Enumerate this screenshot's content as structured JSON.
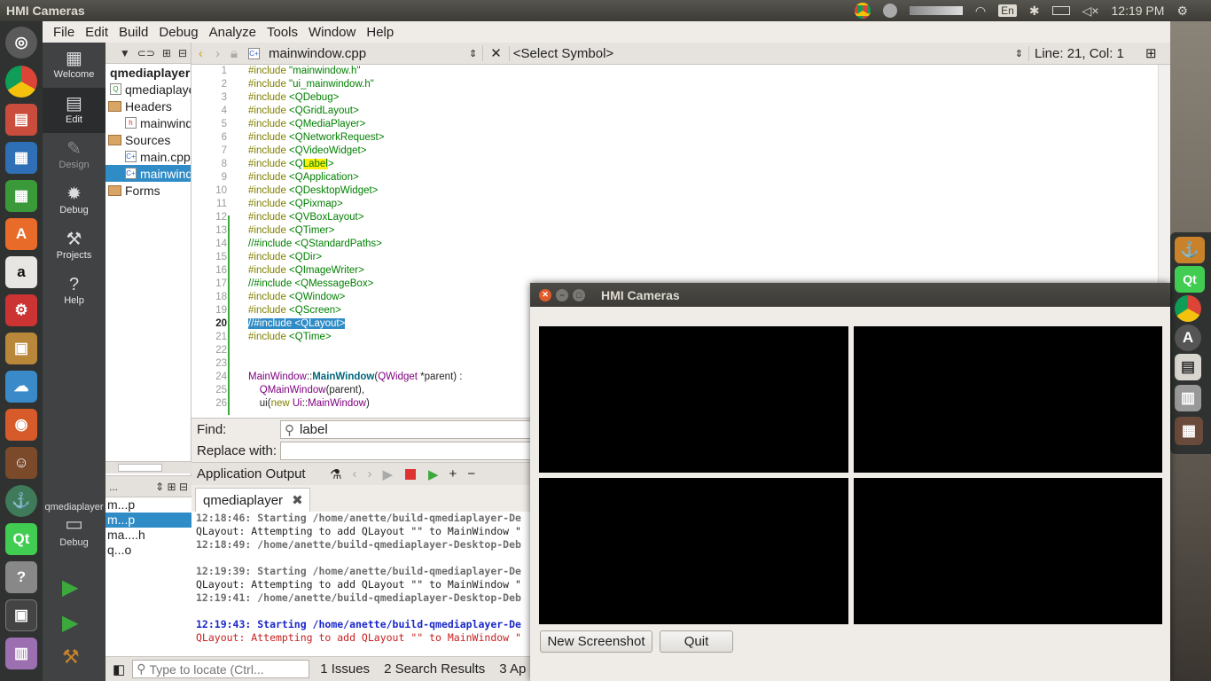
{
  "topbar": {
    "title": "HMI Cameras",
    "time": "12:19 PM",
    "lang": "En"
  },
  "menu": [
    "File",
    "Edit",
    "Build",
    "Debug",
    "Analyze",
    "Tools",
    "Window",
    "Help"
  ],
  "modes": [
    {
      "label": "Welcome",
      "icon": "grid-icon"
    },
    {
      "label": "Edit",
      "icon": "edit-icon"
    },
    {
      "label": "Design",
      "icon": "design-icon"
    },
    {
      "label": "Debug",
      "icon": "bug-icon"
    },
    {
      "label": "Projects",
      "icon": "wrench-icon"
    },
    {
      "label": "Help",
      "icon": "help-icon"
    }
  ],
  "kit": {
    "name": "qmediaplayer",
    "mode": "Debug"
  },
  "project_tree": [
    {
      "text": "qmediaplayer",
      "kind": "project"
    },
    {
      "text": "qmediaplayer",
      "kind": "pro"
    },
    {
      "text": "Headers",
      "kind": "folder"
    },
    {
      "text": "mainwindow.h",
      "kind": "header"
    },
    {
      "text": "Sources",
      "kind": "folder"
    },
    {
      "text": "main.cpp",
      "kind": "cpp"
    },
    {
      "text": "mainwindow.cpp",
      "kind": "cpp",
      "selected": true
    },
    {
      "text": "Forms",
      "kind": "folder"
    }
  ],
  "open_docs": {
    "header": "...",
    "items": [
      "m...p",
      "m...p",
      "ma....h",
      "q...o"
    ]
  },
  "editor": {
    "file": "mainwindow.cpp",
    "symbol": "<Select Symbol>",
    "position": "Line: 21, Col: 1"
  },
  "find": {
    "find_label": "Find:",
    "find_value": "label",
    "replace_label": "Replace with:"
  },
  "output": {
    "title": "Application Output",
    "tab": "qmediaplayer",
    "lines": [
      {
        "t": "12:18:46: Starting /home/anette/build-qmediaplayer-De",
        "c": "gray"
      },
      {
        "t": "QLayout: Attempting to add QLayout \"\" to MainWindow \"",
        "c": "plain"
      },
      {
        "t": "12:18:49: /home/anette/build-qmediaplayer-Desktop-Deb",
        "c": "gray"
      },
      {
        "t": "",
        "c": "plain"
      },
      {
        "t": "12:19:39: Starting /home/anette/build-qmediaplayer-De",
        "c": "gray"
      },
      {
        "t": "QLayout: Attempting to add QLayout \"\" to MainWindow \"",
        "c": "plain"
      },
      {
        "t": "12:19:41: /home/anette/build-qmediaplayer-Desktop-Deb",
        "c": "gray"
      },
      {
        "t": "",
        "c": "plain"
      },
      {
        "t": "12:19:43: Starting /home/anette/build-qmediaplayer-De",
        "c": "blue"
      },
      {
        "t": "QLayout: Attempting to add QLayout \"\" to MainWindow \"",
        "c": "red"
      }
    ]
  },
  "status": {
    "locator_placeholder": "Type to locate (Ctrl...",
    "tabs": [
      "1  Issues",
      "2  Search Results",
      "3  Ap"
    ]
  },
  "hmi": {
    "title": "HMI Cameras",
    "screenshot_label": "New Screenshot",
    "quit_label": "Quit"
  }
}
